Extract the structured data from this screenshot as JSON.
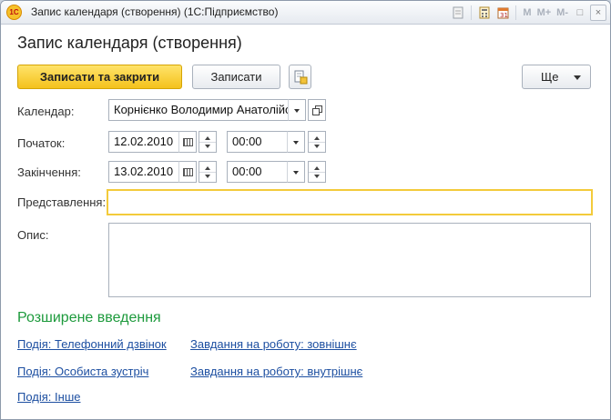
{
  "window": {
    "title": "Запис календаря (створення)  (1С:Підприємство)",
    "app_icon_text": "1С",
    "toolbar_icons": [
      "document-icon",
      "calculator-icon",
      "calendar-icon"
    ],
    "memory_buttons": [
      "M",
      "M+",
      "M-"
    ],
    "restore_label": "□",
    "close_label": "×"
  },
  "form": {
    "title": "Запис календаря (створення)"
  },
  "toolbar": {
    "save_close_label": "Записати та закрити",
    "save_label": "Записати",
    "more_label": "Ще"
  },
  "fields": {
    "calendar": {
      "label": "Календар:",
      "value": "Корнієнко Володимир Анатолійович"
    },
    "start": {
      "label": "Початок:",
      "date": "12.02.2010",
      "time": "00:00"
    },
    "end": {
      "label": "Закінчення:",
      "date": "13.02.2010",
      "time": "00:00"
    },
    "representation": {
      "label": "Представлення:",
      "value": ""
    },
    "description": {
      "label": "Опис:",
      "value": ""
    }
  },
  "advanced": {
    "title": "Розширене введення",
    "links": [
      "Подія: Телефонний дзвінок",
      "Завдання на роботу: зовнішнє",
      "Подія: Особиста зустріч",
      "Завдання на роботу: внутрішнє",
      "Подія: Інше"
    ]
  },
  "colors": {
    "primary_button": "#f4c21c",
    "section_title": "#1d9a3c",
    "link": "#1d4fa1",
    "focus_border": "#f3cb3b"
  }
}
